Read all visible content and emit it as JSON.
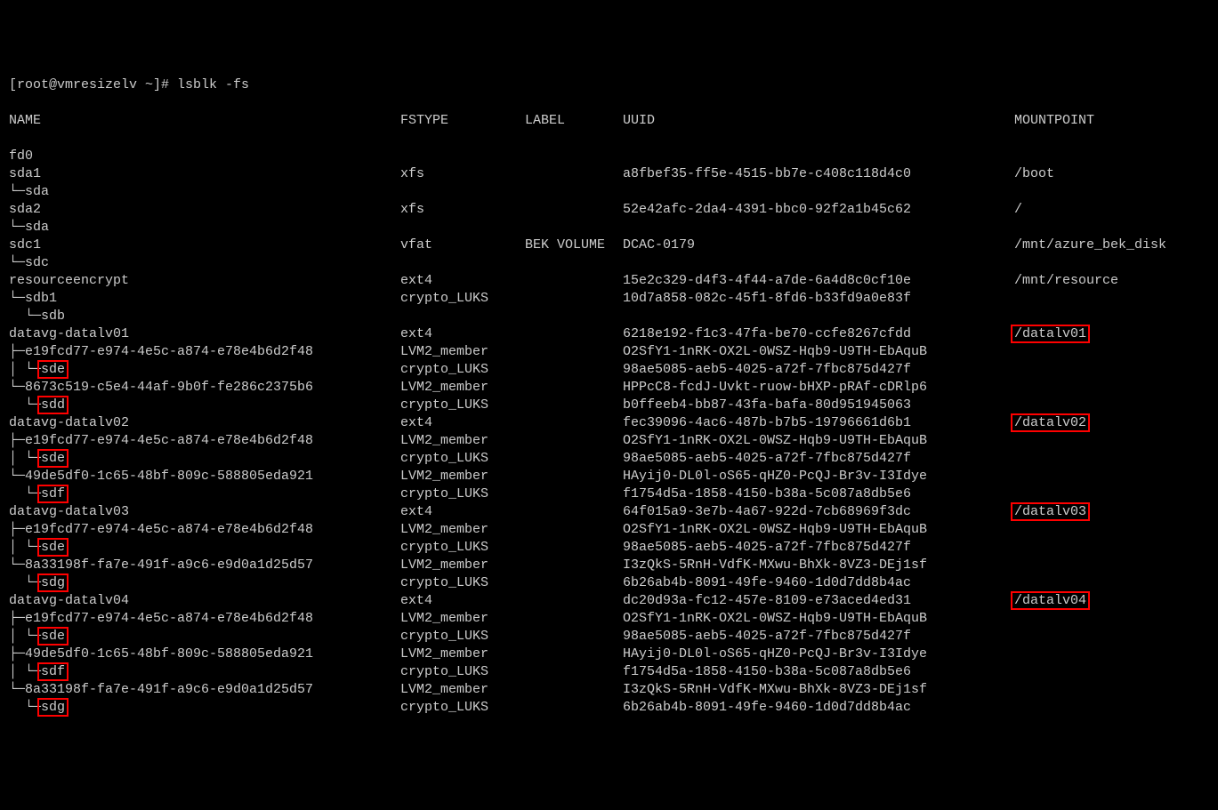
{
  "prompt": "[root@vmresizelv ~]# ",
  "cmd": "lsblk -fs",
  "hdr": {
    "name": "NAME",
    "fstype": "FSTYPE",
    "label": "LABEL",
    "uuid": "UUID",
    "mount": "MOUNTPOINT"
  },
  "rows": [
    {
      "name": "fd0",
      "fstype": "",
      "label": "",
      "uuid": "",
      "mount": "",
      "hl": []
    },
    {
      "name": "sda1",
      "fstype": "xfs",
      "label": "",
      "uuid": "a8fbef35-ff5e-4515-bb7e-c408c118d4c0",
      "mount": "/boot",
      "hl": []
    },
    {
      "name": "└─sda",
      "fstype": "",
      "label": "",
      "uuid": "",
      "mount": "",
      "hl": []
    },
    {
      "name": "sda2",
      "fstype": "xfs",
      "label": "",
      "uuid": "52e42afc-2da4-4391-bbc0-92f2a1b45c62",
      "mount": "/",
      "hl": []
    },
    {
      "name": "└─sda",
      "fstype": "",
      "label": "",
      "uuid": "",
      "mount": "",
      "hl": []
    },
    {
      "name": "sdc1",
      "fstype": "vfat",
      "label": "BEK VOLUME",
      "uuid": "DCAC-0179",
      "mount": "/mnt/azure_bek_disk",
      "hl": []
    },
    {
      "name": "└─sdc",
      "fstype": "",
      "label": "",
      "uuid": "",
      "mount": "",
      "hl": []
    },
    {
      "name": "resourceencrypt",
      "fstype": "ext4",
      "label": "",
      "uuid": "15e2c329-d4f3-4f44-a7de-6a4d8c0cf10e",
      "mount": "/mnt/resource",
      "hl": []
    },
    {
      "name": "└─sdb1",
      "fstype": "crypto_LUKS",
      "label": "",
      "uuid": "10d7a858-082c-45f1-8fd6-b33fd9a0e83f",
      "mount": "",
      "hl": []
    },
    {
      "name": "  └─sdb",
      "fstype": "",
      "label": "",
      "uuid": "",
      "mount": "",
      "hl": []
    },
    {
      "name": "datavg-datalv01",
      "fstype": "ext4",
      "label": "",
      "uuid": "6218e192-f1c3-47fa-be70-ccfe8267cfdd",
      "mount": "/datalv01",
      "hl": [
        "mount"
      ]
    },
    {
      "name": "├─e19fcd77-e974-4e5c-a874-e78e4b6d2f48",
      "fstype": "LVM2_member",
      "label": "",
      "uuid": "O2SfY1-1nRK-OX2L-0WSZ-Hqb9-U9TH-EbAquB",
      "mount": "",
      "hl": []
    },
    {
      "name": "│ └─sde",
      "fstype": "crypto_LUKS",
      "label": "",
      "uuid": "98ae5085-aeb5-4025-a72f-7fbc875d427f",
      "mount": "",
      "hl": [
        "name"
      ]
    },
    {
      "name": "└─8673c519-c5e4-44af-9b0f-fe286c2375b6",
      "fstype": "LVM2_member",
      "label": "",
      "uuid": "HPPcC8-fcdJ-Uvkt-ruow-bHXP-pRAf-cDRlp6",
      "mount": "",
      "hl": []
    },
    {
      "name": "  └─sdd",
      "fstype": "crypto_LUKS",
      "label": "",
      "uuid": "b0ffeeb4-bb87-43fa-bafa-80d951945063",
      "mount": "",
      "hl": [
        "name"
      ]
    },
    {
      "name": "datavg-datalv02",
      "fstype": "ext4",
      "label": "",
      "uuid": "fec39096-4ac6-487b-b7b5-19796661d6b1",
      "mount": "/datalv02",
      "hl": [
        "mount"
      ]
    },
    {
      "name": "├─e19fcd77-e974-4e5c-a874-e78e4b6d2f48",
      "fstype": "LVM2_member",
      "label": "",
      "uuid": "O2SfY1-1nRK-OX2L-0WSZ-Hqb9-U9TH-EbAquB",
      "mount": "",
      "hl": []
    },
    {
      "name": "│ └─sde",
      "fstype": "crypto_LUKS",
      "label": "",
      "uuid": "98ae5085-aeb5-4025-a72f-7fbc875d427f",
      "mount": "",
      "hl": [
        "name"
      ]
    },
    {
      "name": "└─49de5df0-1c65-48bf-809c-588805eda921",
      "fstype": "LVM2_member",
      "label": "",
      "uuid": "HAyij0-DL0l-oS65-qHZ0-PcQJ-Br3v-I3Idye",
      "mount": "",
      "hl": []
    },
    {
      "name": "  └─sdf",
      "fstype": "crypto_LUKS",
      "label": "",
      "uuid": "f1754d5a-1858-4150-b38a-5c087a8db5e6",
      "mount": "",
      "hl": [
        "name"
      ]
    },
    {
      "name": "datavg-datalv03",
      "fstype": "ext4",
      "label": "",
      "uuid": "64f015a9-3e7b-4a67-922d-7cb68969f3dc",
      "mount": "/datalv03",
      "hl": [
        "mount"
      ]
    },
    {
      "name": "├─e19fcd77-e974-4e5c-a874-e78e4b6d2f48",
      "fstype": "LVM2_member",
      "label": "",
      "uuid": "O2SfY1-1nRK-OX2L-0WSZ-Hqb9-U9TH-EbAquB",
      "mount": "",
      "hl": []
    },
    {
      "name": "│ └─sde",
      "fstype": "crypto_LUKS",
      "label": "",
      "uuid": "98ae5085-aeb5-4025-a72f-7fbc875d427f",
      "mount": "",
      "hl": [
        "name"
      ]
    },
    {
      "name": "└─8a33198f-fa7e-491f-a9c6-e9d0a1d25d57",
      "fstype": "LVM2_member",
      "label": "",
      "uuid": "I3zQkS-5RnH-VdfK-MXwu-BhXk-8VZ3-DEj1sf",
      "mount": "",
      "hl": []
    },
    {
      "name": "  └─sdg",
      "fstype": "crypto_LUKS",
      "label": "",
      "uuid": "6b26ab4b-8091-49fe-9460-1d0d7dd8b4ac",
      "mount": "",
      "hl": [
        "name"
      ]
    },
    {
      "name": "datavg-datalv04",
      "fstype": "ext4",
      "label": "",
      "uuid": "dc20d93a-fc12-457e-8109-e73aced4ed31",
      "mount": "/datalv04",
      "hl": [
        "mount"
      ]
    },
    {
      "name": "├─e19fcd77-e974-4e5c-a874-e78e4b6d2f48",
      "fstype": "LVM2_member",
      "label": "",
      "uuid": "O2SfY1-1nRK-OX2L-0WSZ-Hqb9-U9TH-EbAquB",
      "mount": "",
      "hl": []
    },
    {
      "name": "│ └─sde",
      "fstype": "crypto_LUKS",
      "label": "",
      "uuid": "98ae5085-aeb5-4025-a72f-7fbc875d427f",
      "mount": "",
      "hl": [
        "name"
      ]
    },
    {
      "name": "├─49de5df0-1c65-48bf-809c-588805eda921",
      "fstype": "LVM2_member",
      "label": "",
      "uuid": "HAyij0-DL0l-oS65-qHZ0-PcQJ-Br3v-I3Idye",
      "mount": "",
      "hl": []
    },
    {
      "name": "│ └─sdf",
      "fstype": "crypto_LUKS",
      "label": "",
      "uuid": "f1754d5a-1858-4150-b38a-5c087a8db5e6",
      "mount": "",
      "hl": [
        "name"
      ]
    },
    {
      "name": "└─8a33198f-fa7e-491f-a9c6-e9d0a1d25d57",
      "fstype": "LVM2_member",
      "label": "",
      "uuid": "I3zQkS-5RnH-VdfK-MXwu-BhXk-8VZ3-DEj1sf",
      "mount": "",
      "hl": []
    },
    {
      "name": "  └─sdg",
      "fstype": "crypto_LUKS",
      "label": "",
      "uuid": "6b26ab4b-8091-49fe-9460-1d0d7dd8b4ac",
      "mount": "",
      "hl": [
        "name"
      ]
    }
  ]
}
